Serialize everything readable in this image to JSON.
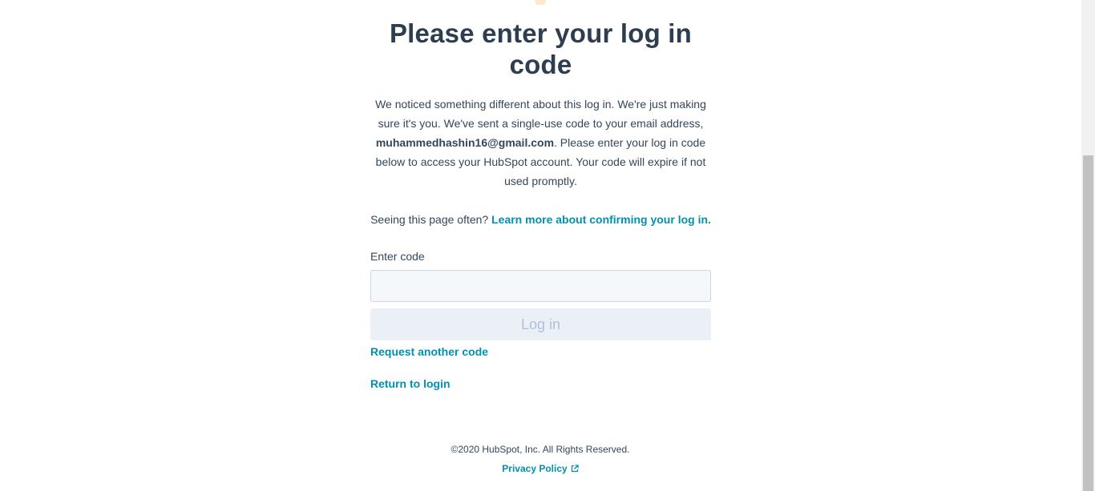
{
  "heading": "Please enter your log in code",
  "description": {
    "before_email": "We noticed something different about this log in. We're just making sure it's you. We've sent a single-use code to your email address, ",
    "email": "muhammedhashin16@gmail.com",
    "after_email": ". Please enter your log in code below to access your HubSpot account. Your code will expire if not used promptly."
  },
  "help": {
    "prefix": "Seeing this page often? ",
    "link_label": "Learn more about confirming your log in."
  },
  "form": {
    "code_label": "Enter code",
    "code_value": "",
    "code_placeholder": "",
    "login_button": "Log in",
    "request_code_link": "Request another code",
    "return_link": "Return to login"
  },
  "footer": {
    "copyright": "©2020 HubSpot, Inc. All Rights Reserved.",
    "privacy_link": "Privacy Policy"
  },
  "colors": {
    "link": "#0091ae",
    "heading": "#2d3e50",
    "text": "#33475b",
    "input_bg": "#f5f8fa",
    "disabled_button_bg": "#eaf0f6",
    "disabled_button_text": "#b0c1d4"
  },
  "icons": {
    "external_link": "external-link-icon"
  }
}
